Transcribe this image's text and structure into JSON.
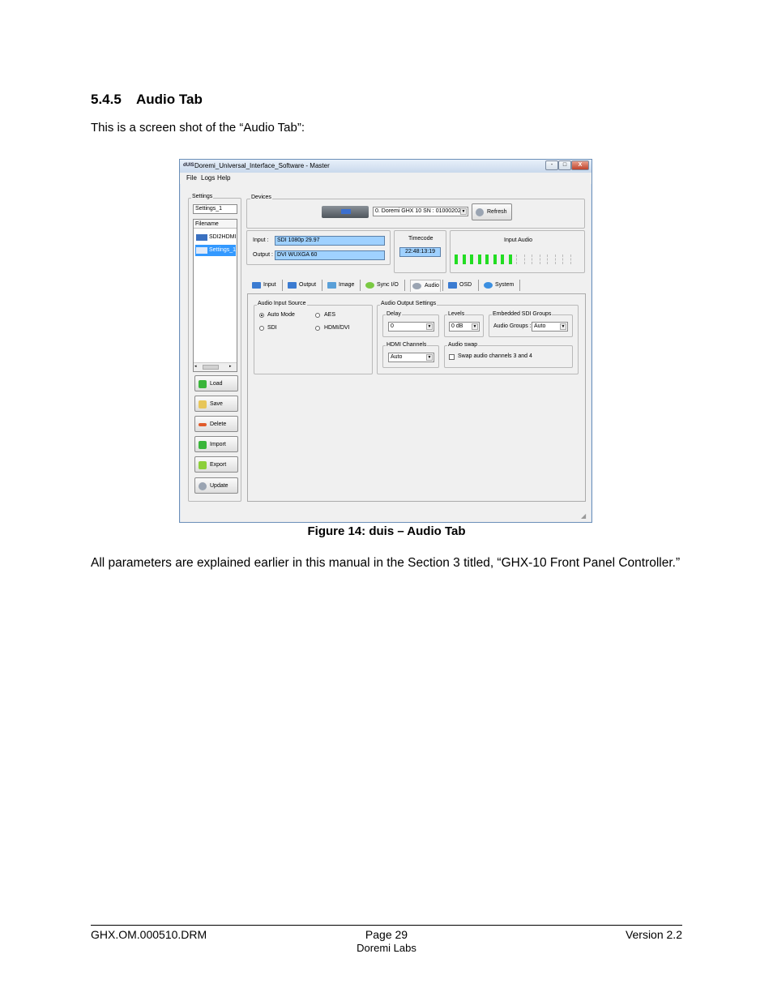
{
  "section": {
    "number": "5.4.5",
    "title": "Audio Tab"
  },
  "intro": "This is a screen shot of the “Audio Tab”:",
  "window": {
    "title": "Doremi_Universal_Interface_Software - Master",
    "logo_text": "dUIS",
    "controls": [
      "-",
      "□",
      "X"
    ],
    "menu": [
      "File",
      "Logs",
      "Help"
    ],
    "settings": {
      "label": "Settings",
      "name_value": "Settings_1",
      "list_header": "Filename",
      "items": [
        "SDI2HDMI",
        "Settings_1"
      ],
      "buttons": [
        "Load",
        "Save",
        "Delete",
        "Import",
        "Export",
        "Update"
      ]
    },
    "devices": {
      "label": "Devices",
      "selected_device": "0. Doremi GHX 10 SN : 01000202",
      "refresh": "Refresh",
      "input_label": "Input :",
      "input_value": "SDI 1080p 29.97",
      "output_label": "Output :",
      "output_value": "DVI WUXGA 60",
      "timecode_label": "Timecode",
      "timecode_value": "22:48:13:19",
      "input_audio_label": "Input Audio",
      "meter_levels": [
        1,
        1,
        1,
        1,
        1,
        1,
        1,
        1,
        0,
        0,
        0,
        0,
        0,
        0,
        0,
        0
      ]
    },
    "tabs": [
      "Input",
      "Output",
      "Image",
      "Sync I/O",
      "Audio",
      "OSD",
      "System"
    ],
    "audio_input_source": {
      "label": "Audio Input Source",
      "options": [
        "Auto Mode",
        "AES",
        "SDI",
        "HDMI/DVI"
      ],
      "selected": "Auto Mode"
    },
    "audio_output_settings": {
      "label": "Audio Output Settings",
      "delay_label": "Delay",
      "delay_value": "0",
      "levels_label": "Levels",
      "levels_value": "0 dB",
      "embedded_label": "Embedded SDI Groups",
      "audio_groups_label": "Audio Groups :",
      "audio_groups_value": "Auto",
      "hdmi_label": "HDMI Channels",
      "hdmi_value": "Auto",
      "swap_label": "Audio swap",
      "swap_text": "Swap audio channels 3 and 4"
    }
  },
  "caption": "Figure 14: duis – Audio Tab",
  "paragraph": "All parameters are explained earlier in this manual in the Section 3  titled, “GHX-10 Front Panel Controller.”",
  "footer": {
    "left": "GHX.OM.000510.DRM",
    "center": "Page 29",
    "sub": "Doremi Labs",
    "right": "Version 2.2"
  }
}
